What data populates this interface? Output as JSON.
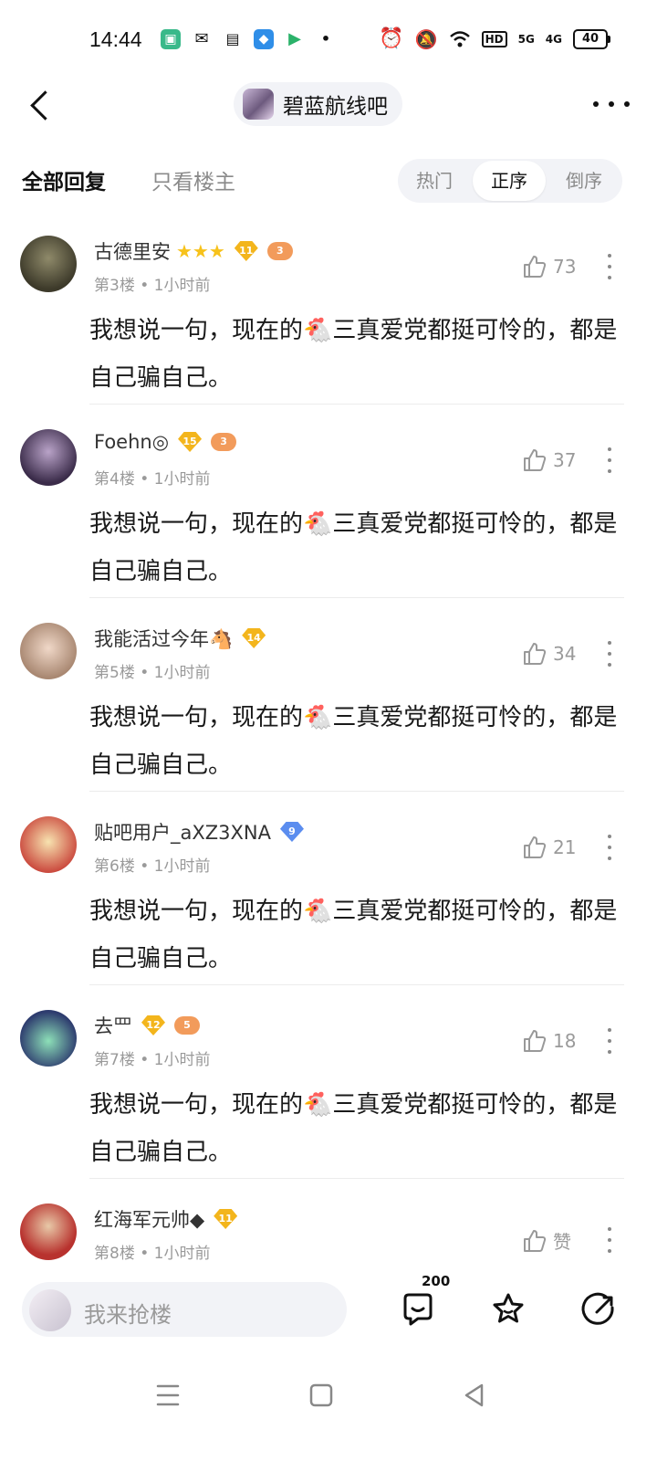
{
  "status_bar": {
    "time": "14:44",
    "network_5g": "5G",
    "network_4g": "4G",
    "hd_label": "HD",
    "battery": "40",
    "icons": [
      "app-icon",
      "wechat-icon",
      "taobao-icon",
      "app-icon",
      "video-icon",
      "dot-icon",
      "alarm-icon",
      "mute-icon",
      "wifi-icon"
    ]
  },
  "header": {
    "forum_name": "碧蓝航线吧"
  },
  "tabs": {
    "all_replies": "全部回复",
    "owner_only": "只看楼主",
    "sort_hot": "热门",
    "sort_asc": "正序",
    "sort_desc": "倒序"
  },
  "posts": [
    {
      "username": "古德里安",
      "level": "11",
      "game_badge": "3",
      "floor": "第3楼",
      "time": "1小时前",
      "likes": "73",
      "content": "我想说一句，现在的🐔三真爱党都挺可怜的，都是自己骗自己。"
    },
    {
      "username": "Foehn◎",
      "level": "15",
      "game_badge": "3",
      "floor": "第4楼",
      "time": "1小时前",
      "likes": "37",
      "content": "我想说一句，现在的🐔三真爱党都挺可怜的，都是自己骗自己。"
    },
    {
      "username": "我能活过今年🐴",
      "level": "14",
      "game_badge": "",
      "floor": "第5楼",
      "time": "1小时前",
      "likes": "34",
      "content": "我想说一句，现在的🐔三真爱党都挺可怜的，都是自己骗自己。"
    },
    {
      "username": "贴吧用户_aXZ3XNA",
      "level": "9",
      "game_badge": "",
      "floor": "第6楼",
      "time": "1小时前",
      "likes": "21",
      "content": "我想说一句，现在的🐔三真爱党都挺可怜的，都是自己骗自己。"
    },
    {
      "username": "去罒",
      "level": "12",
      "game_badge": "5",
      "floor": "第7楼",
      "time": "1小时前",
      "likes": "18",
      "content": "我想说一句，现在的🐔三真爱党都挺可怜的，都是自己骗自己。"
    },
    {
      "username": "红海军元帅◆",
      "level": "11",
      "game_badge": "",
      "floor": "第8楼",
      "time": "1小时前",
      "likes": "赞",
      "content": ""
    }
  ],
  "meta_separator": "•",
  "bottom_bar": {
    "reply_placeholder": "我来抢楼",
    "comment_count": "200"
  },
  "colors": {
    "level_badge": "#f3b51c",
    "level_badge_blue": "#5b8def",
    "game_badge": "#f29b5b",
    "accent": "#111111"
  }
}
